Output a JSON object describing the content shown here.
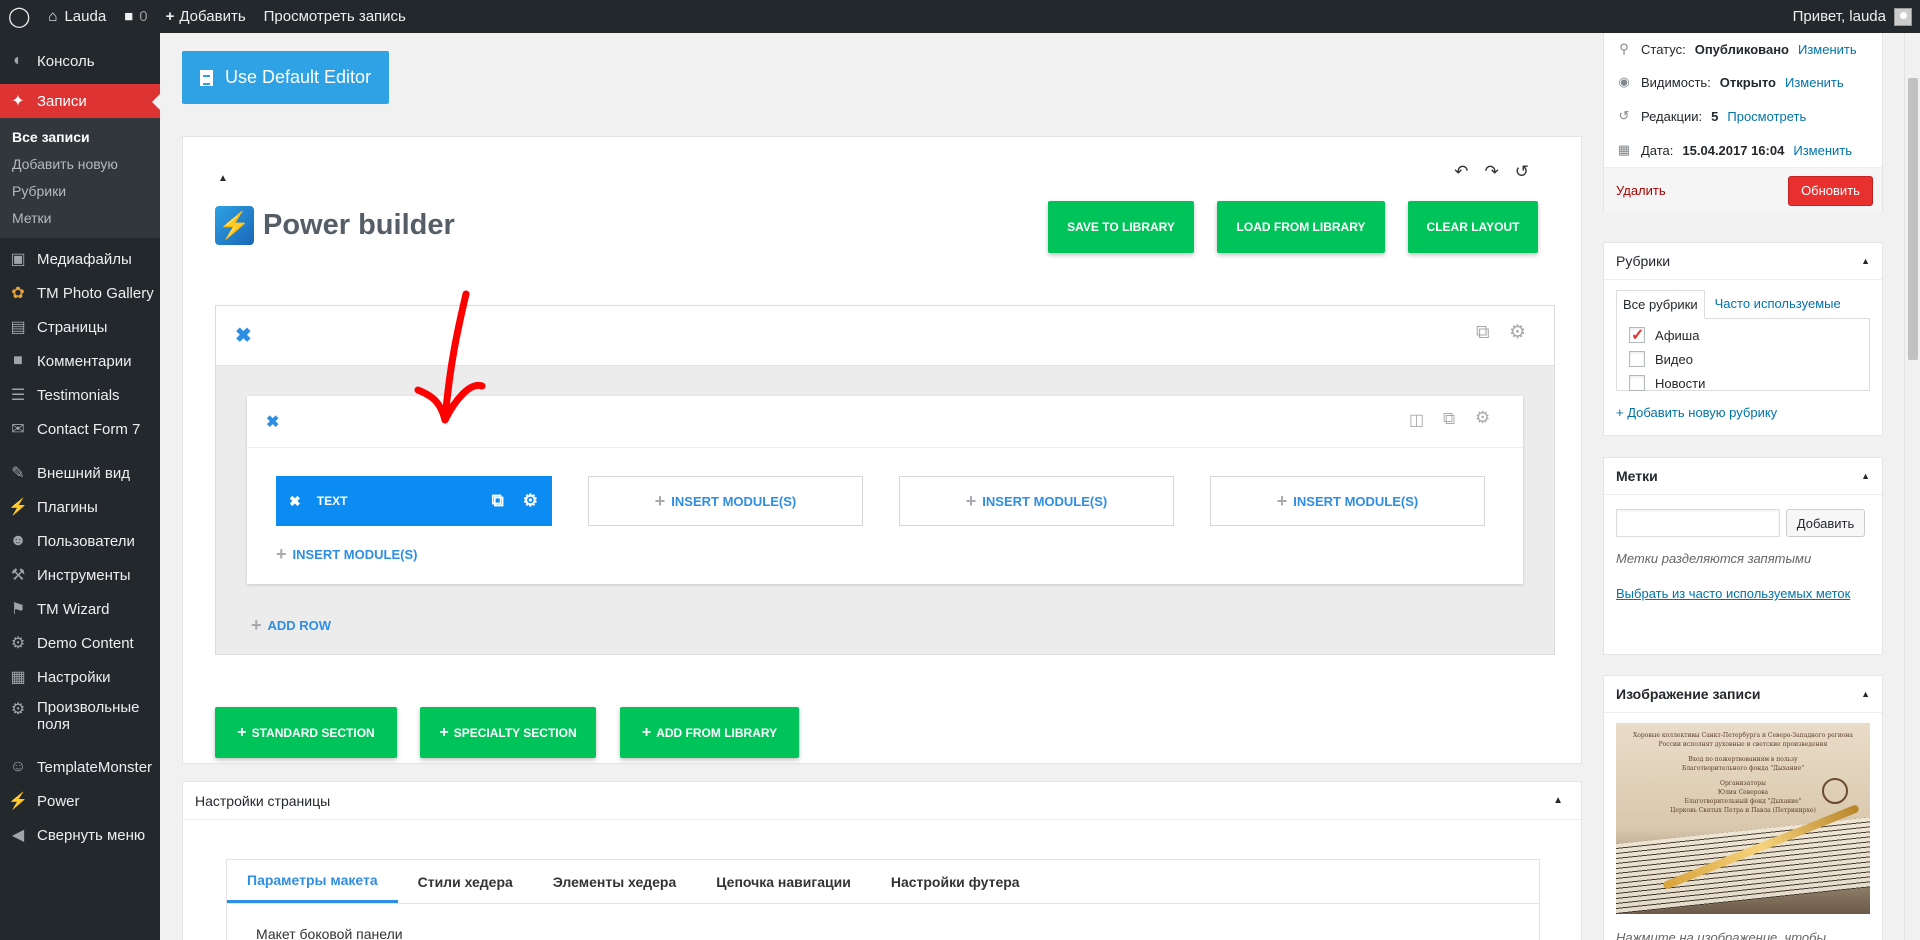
{
  "adminbar": {
    "site_name": "Lauda",
    "comments_count": "0",
    "add_label": "Добавить",
    "view_post_label": "Просмотреть запись",
    "greeting": "Привет, lauda"
  },
  "sidebar": {
    "items": [
      {
        "label": "Консоль",
        "icon": "dashboard-icon"
      },
      {
        "label": "Записи",
        "icon": "pin-icon"
      },
      {
        "label": "Медиафайлы",
        "icon": "media-icon"
      },
      {
        "label": "TM Photo Gallery",
        "icon": "gallery-icon"
      },
      {
        "label": "Страницы",
        "icon": "pages-icon"
      },
      {
        "label": "Комментарии",
        "icon": "comments-icon"
      },
      {
        "label": "Testimonials",
        "icon": "testimonials-icon"
      },
      {
        "label": "Contact Form 7",
        "icon": "mail-icon"
      },
      {
        "label": "Внешний вид",
        "icon": "brush-icon"
      },
      {
        "label": "Плагины",
        "icon": "plugin-icon"
      },
      {
        "label": "Пользователи",
        "icon": "users-icon"
      },
      {
        "label": "Инструменты",
        "icon": "wrench-icon"
      },
      {
        "label": "TM Wizard",
        "icon": "flag-icon"
      },
      {
        "label": "Demo Content",
        "icon": "demo-icon"
      },
      {
        "label": "Настройки",
        "icon": "settings-icon"
      },
      {
        "label": "Произвольные поля",
        "icon": "gear-icon"
      },
      {
        "label": "TemplateMonster",
        "icon": "templatemonster-icon"
      },
      {
        "label": "Power",
        "icon": "power-icon"
      },
      {
        "label": "Свернуть меню",
        "icon": "collapse-icon"
      }
    ],
    "submenu": [
      "Все записи",
      "Добавить новую",
      "Рубрики",
      "Метки"
    ]
  },
  "editor": {
    "default_editor_label": "Use Default Editor",
    "builder_title": "Power builder",
    "save_library": "SAVE TO LIBRARY",
    "load_library": "LOAD FROM LIBRARY",
    "clear_layout": "CLEAR LAYOUT",
    "module_text": "TEXT",
    "insert_module": "INSERT MODULE(S)",
    "add_row": "ADD ROW",
    "standard_section": "STANDARD SECTION",
    "specialty_section": "SPECIALTY SECTION",
    "add_from_library": "ADD FROM LIBRARY"
  },
  "page_settings": {
    "title": "Настройки страницы",
    "tabs": [
      "Параметры макета",
      "Стили хедера",
      "Элементы хедера",
      "Цепочка навигации",
      "Настройки футера"
    ],
    "sidebar_layout_label": "Макет боковой панели"
  },
  "publish": {
    "status_label": "Статус:",
    "status_value": "Опубликовано",
    "visibility_label": "Видимость:",
    "visibility_value": "Открыто",
    "revisions_label": "Редакции:",
    "revisions_value": "5",
    "revisions_link": "Просмотреть",
    "date_label": "Дата:",
    "date_value": "15.04.2017 16:04",
    "change_link": "Изменить",
    "delete_label": "Удалить",
    "update_label": "Обновить"
  },
  "categories": {
    "title": "Рубрики",
    "tab_all": "Все рубрики",
    "tab_popular": "Часто используемые",
    "items": [
      {
        "label": "Афиша",
        "checked": true
      },
      {
        "label": "Видео",
        "checked": false
      },
      {
        "label": "Новости",
        "checked": false
      }
    ],
    "add_new": "+ Добавить новую рубрику"
  },
  "tags": {
    "title": "Метки",
    "add_button": "Добавить",
    "hint": "Метки разделяются запятыми",
    "choose_link": "Выбрать из часто используемых меток"
  },
  "featured_image": {
    "title": "Изображение записи",
    "poster_lines": [
      "Хоровые коллективы Санкт-Петербурга и Северо-Западного региона",
      "России исполнят духовные и светские произведения",
      "Вход по пожертвованиям в пользу",
      "Благотворительного фонда \"Дыхание\"",
      "Организаторы",
      "Юлия Северова",
      "Благотворительный фонд \"Дыхание\"",
      "Церковь Святых Петра и Павла (Петрикирхе)"
    ],
    "hint": "Нажмите на изображение, чтобы изменить или обновить его"
  },
  "colors": {
    "accent_blue": "#2e8ee4",
    "green": "#00c35a",
    "wp_red": "#dd3333"
  }
}
